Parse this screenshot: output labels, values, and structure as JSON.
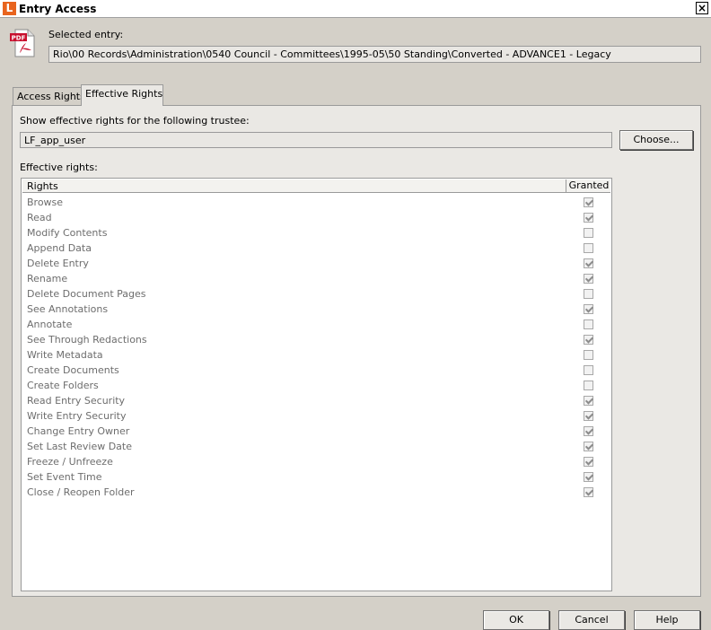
{
  "window": {
    "app_icon_letter": "L",
    "title": "Entry Access",
    "close_glyph": "×"
  },
  "entry": {
    "icon": "pdf-file-icon",
    "icon_badge": "PDF",
    "label": "Selected entry:",
    "path": "Rio\\00 Records\\Administration\\0540 Council - Committees\\1995-05\\50 Standing\\Converted - ADVANCE1 -  Legacy"
  },
  "tabs": [
    {
      "label": "Access Rights",
      "active": false
    },
    {
      "label": "Effective Rights",
      "active": true
    }
  ],
  "effective": {
    "trustee_label": "Show effective rights for the following trustee:",
    "trustee_value": "LF_app_user",
    "choose_label": "Choose...",
    "rights_label": "Effective rights:",
    "columns": {
      "rights": "Rights",
      "granted": "Granted"
    },
    "rows": [
      {
        "label": "Browse",
        "granted": true
      },
      {
        "label": "Read",
        "granted": true
      },
      {
        "label": "Modify Contents",
        "granted": false
      },
      {
        "label": "Append Data",
        "granted": false
      },
      {
        "label": "Delete Entry",
        "granted": true
      },
      {
        "label": "Rename",
        "granted": true
      },
      {
        "label": "Delete Document Pages",
        "granted": false
      },
      {
        "label": "See Annotations",
        "granted": true
      },
      {
        "label": "Annotate",
        "granted": false
      },
      {
        "label": "See Through Redactions",
        "granted": true
      },
      {
        "label": "Write Metadata",
        "granted": false
      },
      {
        "label": "Create Documents",
        "granted": false
      },
      {
        "label": "Create Folders",
        "granted": false
      },
      {
        "label": "Read Entry Security",
        "granted": true
      },
      {
        "label": "Write Entry Security",
        "granted": true
      },
      {
        "label": "Change Entry Owner",
        "granted": true
      },
      {
        "label": "Set Last Review Date",
        "granted": true
      },
      {
        "label": "Freeze / Unfreeze",
        "granted": true
      },
      {
        "label": "Set Event Time",
        "granted": true
      },
      {
        "label": "Close / Reopen Folder",
        "granted": true
      }
    ]
  },
  "footer": {
    "ok": "OK",
    "cancel": "Cancel",
    "help": "Help"
  },
  "colors": {
    "dialog_bg": "#d4d0c8",
    "panel_bg": "#eae8e4",
    "app_icon": "#e8641e",
    "pdf_red": "#c8102e"
  }
}
